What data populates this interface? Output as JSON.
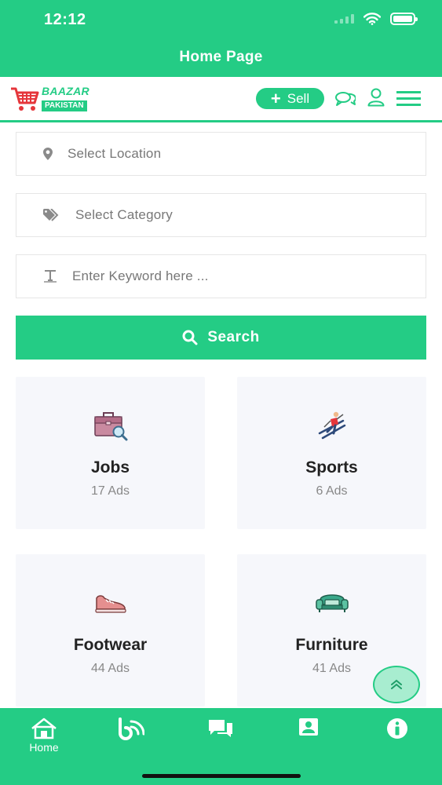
{
  "status_bar": {
    "time": "12:12"
  },
  "app_bar": {
    "title": "Home Page"
  },
  "header": {
    "logo_top": "BAAZAR",
    "logo_bottom": "PAKISTAN",
    "sell_label": "Sell",
    "icons": [
      "chat-icon",
      "user-icon",
      "menu-icon"
    ]
  },
  "filters": {
    "location_placeholder": "Select Location",
    "category_placeholder": "Select Category",
    "keyword_placeholder": "Enter Keyword here ..."
  },
  "search": {
    "label": "Search"
  },
  "categories": [
    {
      "name": "Jobs",
      "count": "17 Ads",
      "icon": "briefcase-icon"
    },
    {
      "name": "Sports",
      "count": "6 Ads",
      "icon": "skier-icon"
    },
    {
      "name": "Footwear",
      "count": "44 Ads",
      "icon": "sneaker-icon"
    },
    {
      "name": "Furniture",
      "count": "41 Ads",
      "icon": "sofa-icon"
    }
  ],
  "bottom_nav": [
    {
      "label": "Home",
      "icon": "home-icon"
    },
    {
      "label": "",
      "icon": "blog-icon"
    },
    {
      "label": "",
      "icon": "messages-icon"
    },
    {
      "label": "",
      "icon": "contact-card-icon"
    },
    {
      "label": "",
      "icon": "info-icon"
    }
  ],
  "colors": {
    "brand": "#24cc85",
    "card_bg": "#f6f7fb",
    "logo_red": "#e5363b"
  }
}
